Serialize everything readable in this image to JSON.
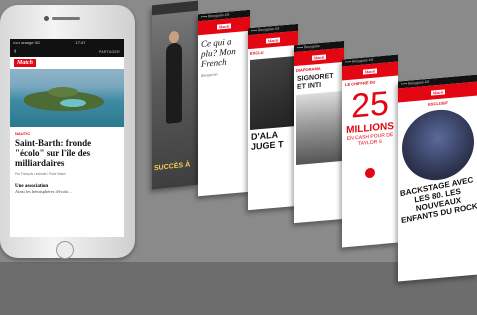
{
  "phone": {
    "status_left": "••••• orange  3G",
    "status_time": "17:47",
    "status_right": "",
    "nav_back": "‹",
    "share_label": "PARTAGER",
    "logo": "Match",
    "kicker": "NAUTIC",
    "headline": "Saint-Barth: fronde \"écolo\" sur l'île des milliardaires",
    "byline": "Par François Lestrade / Paris Match",
    "subhead": "Une association",
    "subhead2": "Ainsi les hémisphères d'écolo..."
  },
  "cards": {
    "c1_bottom": "SUCCÈS À",
    "c2_status": "••••• Bouygues  4G",
    "c2_question": "Ce qui a plu? Mon French",
    "c2_author": "Benjamin",
    "c3_status": "••••• Bouygues 4G",
    "c3_kicker": "EXCLU",
    "c3_big": "D'ALA JUGE T",
    "c4_status": "••••• Bouygues",
    "c4_kicker": "DIAPORAMA",
    "c4_big": "SIGNORET ET INTI",
    "c5_status": "••••• Bouygues 4G",
    "c5_kicker": "LE CHIFFRE DU",
    "c5_number": "25",
    "c5_millions": "MILLIONS",
    "c5_desc": "EN CASH POUR DE TAYLOR S",
    "c6_status": "••••• Bouygues 4G",
    "c6_kicker": "EXCLUSIF",
    "c6_big": "BACKSTAGE AVEC LES 80. LES NOUVEAUX ENFANTS DU ROCK"
  },
  "colors": {
    "brand_red": "#e30613",
    "background": "#8a8a8a"
  }
}
